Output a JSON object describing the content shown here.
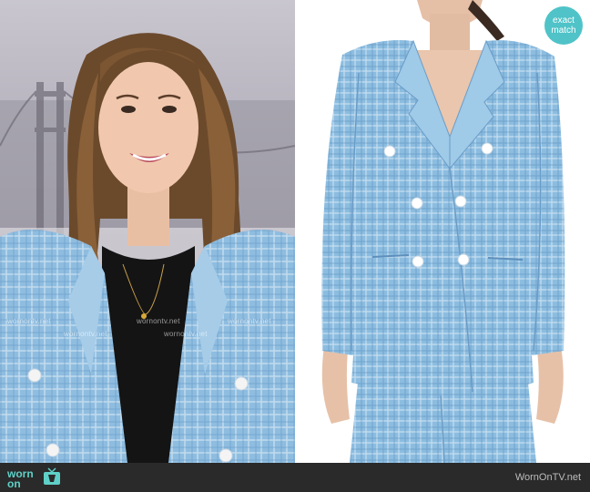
{
  "watermark": "wornontv.net",
  "badge": {
    "line1": "exact",
    "line2": "match"
  },
  "footer": {
    "logo_line1": "worn",
    "logo_line2": "on",
    "site": "WornOnTV.net"
  },
  "colors": {
    "jacket_blue": "#8cbde0",
    "badge_teal": "#4fc3c8",
    "footer_bg": "#2a2a2a",
    "logo_teal": "#5fd0c7"
  }
}
